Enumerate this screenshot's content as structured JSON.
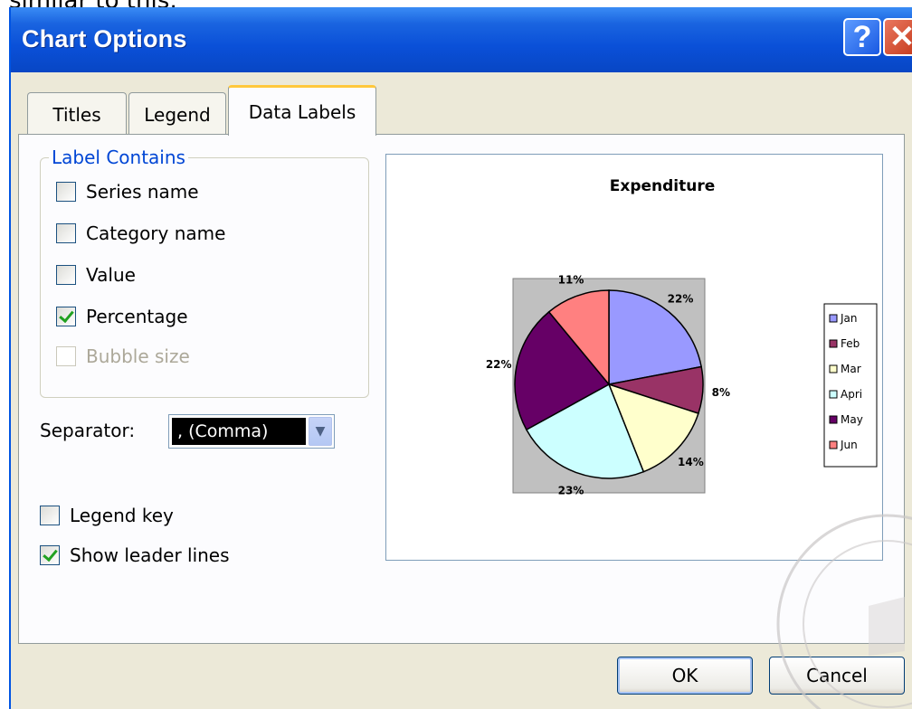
{
  "header_text": "similar to this:",
  "window": {
    "title": "Chart Options",
    "help_symbol": "?",
    "close_symbol": "✕"
  },
  "tabs": [
    {
      "label": "Titles",
      "active": false
    },
    {
      "label": "Legend",
      "active": false
    },
    {
      "label": "Data Labels",
      "active": true
    }
  ],
  "label_contains": {
    "legend": "Label Contains",
    "options": [
      {
        "label": "Series name",
        "checked": false,
        "enabled": true
      },
      {
        "label": "Category name",
        "checked": false,
        "enabled": true
      },
      {
        "label": "Value",
        "checked": false,
        "enabled": true
      },
      {
        "label": "Percentage",
        "checked": true,
        "enabled": true
      },
      {
        "label": "Bubble size",
        "checked": false,
        "enabled": false
      }
    ]
  },
  "separator": {
    "label": "Separator:",
    "value": ", (Comma)"
  },
  "extra_options": [
    {
      "label": "Legend key",
      "checked": false
    },
    {
      "label": "Show leader lines",
      "checked": true
    }
  ],
  "chart_data": {
    "type": "pie",
    "title": "Expenditure",
    "categories": [
      "Jan",
      "Feb",
      "Mar",
      "April",
      "May",
      "Jun"
    ],
    "values": [
      22,
      8,
      14,
      23,
      22,
      11
    ],
    "data_labels": [
      "22%",
      "8%",
      "14%",
      "23%",
      "22%",
      "11%"
    ],
    "colors": [
      "#9999ff",
      "#993366",
      "#ffffcc",
      "#ccffff",
      "#660066",
      "#ff8080"
    ],
    "legend": [
      "Jan",
      "Feb",
      "Mar",
      "Apri",
      "May",
      "Jun"
    ],
    "legend_position": "right",
    "plot_area_color": "#c0c0c0"
  },
  "buttons": {
    "ok": "OK",
    "cancel": "Cancel"
  },
  "colors": {
    "title_bar": "#0a50d8",
    "dialog_bg": "#ece9d8",
    "active_tab_accent": "#ffc83c",
    "groupbox_text": "#0046d5"
  }
}
